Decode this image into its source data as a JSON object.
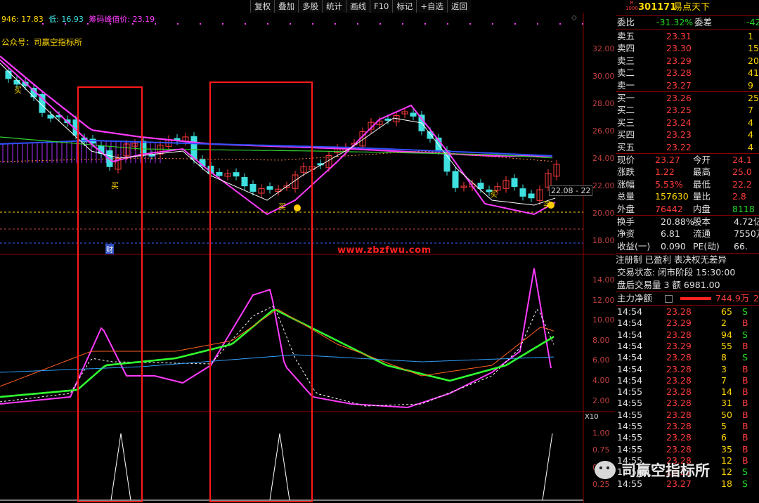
{
  "header_info": {
    "ma1": "946: 17.83",
    "ma2": "低: 16.93",
    "chip": "筹码峰值价: 23.19"
  },
  "watermark_top": "公众号：司赢空指标所",
  "watermark_mid": "www.zbzfwu.com",
  "brand_watermark": "司赢空指标所",
  "toolbar": [
    "复权",
    "叠加",
    "多股",
    "统计",
    "画线",
    "F10",
    "标记",
    "+自选",
    "返回"
  ],
  "price_axis": [
    "32.00",
    "30.00",
    "28.00",
    "26.00",
    "24.00",
    "22.00",
    "20.00",
    "18.00"
  ],
  "mid_axis": [
    "14.00",
    "12.00",
    "10.00",
    "8.00",
    "6.00",
    "4.00",
    "2.00"
  ],
  "low_axis": [
    "1.00",
    "0.75",
    "0.50",
    "0.25"
  ],
  "low_axis_label": "X10",
  "price_tag": "22.08 - 22",
  "labels": {
    "buy": "买",
    "cai": "财"
  },
  "stock": {
    "code": "301171",
    "name": "易点天下",
    "badge_top": "R",
    "badge_bottom": "1000"
  },
  "wei": {
    "label1": "委比",
    "val1": "-31.32%",
    "label2": "委差",
    "val2": "-42"
  },
  "asks": [
    {
      "label": "卖五",
      "price": "23.31",
      "vol": "1"
    },
    {
      "label": "卖四",
      "price": "23.30",
      "vol": "15"
    },
    {
      "label": "卖三",
      "price": "23.29",
      "vol": "20"
    },
    {
      "label": "卖二",
      "price": "23.28",
      "vol": "41"
    },
    {
      "label": "卖一",
      "price": "23.27",
      "vol": "9"
    }
  ],
  "bids": [
    {
      "label": "买一",
      "price": "23.26",
      "vol": "25"
    },
    {
      "label": "买二",
      "price": "23.25",
      "vol": "7"
    },
    {
      "label": "买三",
      "price": "23.24",
      "vol": "4"
    },
    {
      "label": "买四",
      "price": "23.23",
      "vol": "4"
    },
    {
      "label": "买五",
      "price": "23.22",
      "vol": "4"
    }
  ],
  "quote": [
    {
      "l1": "现价",
      "v1": "23.27",
      "c1": "red",
      "l2": "今开",
      "v2": "24.1",
      "c2": "red"
    },
    {
      "l1": "涨跌",
      "v1": "1.22",
      "c1": "red",
      "l2": "最高",
      "v2": "25.0",
      "c2": "red"
    },
    {
      "l1": "涨幅",
      "v1": "5.53%",
      "c1": "red",
      "l2": "最低",
      "v2": "22.2",
      "c2": "red"
    },
    {
      "l1": "总量",
      "v1": "157630",
      "c1": "yellow",
      "l2": "量比",
      "v2": "2.8",
      "c2": "red"
    },
    {
      "l1": "外盘",
      "v1": "76442",
      "c1": "red",
      "l2": "内盘",
      "v2": "8118",
      "c2": "green"
    }
  ],
  "fund": [
    {
      "l1": "换手",
      "v1": "20.88%",
      "l2": "股本",
      "v2": "4.72亿"
    },
    {
      "l1": "净资",
      "v1": "6.81",
      "l2": "流通",
      "v2": "7550万"
    },
    {
      "l1": "收益(一)",
      "v1": "0.090",
      "l2": "PE(动)",
      "v2": "66."
    }
  ],
  "info_lines": [
    "注册制 已盈利 表决权无差异",
    "交易状态: 闭市阶段 15:30:00",
    "盘后交易量 3 额 6981.00"
  ],
  "main_flow": {
    "label": "主力净额",
    "value": "744.9万",
    "tail": "2"
  },
  "ticks": [
    {
      "t": "14:54",
      "p": "23.28",
      "v": "65",
      "s": "S"
    },
    {
      "t": "14:54",
      "p": "23.29",
      "v": "2",
      "s": "B"
    },
    {
      "t": "14:54",
      "p": "23.28",
      "v": "94",
      "s": "S"
    },
    {
      "t": "14:54",
      "p": "23.29",
      "v": "55",
      "s": "B"
    },
    {
      "t": "14:54",
      "p": "23.28",
      "v": "8",
      "s": "S"
    },
    {
      "t": "14:54",
      "p": "23.28",
      "v": "3",
      "s": "B"
    },
    {
      "t": "14:54",
      "p": "23.28",
      "v": "7",
      "s": "B"
    },
    {
      "t": "14:55",
      "p": "23.28",
      "v": "14",
      "s": "B"
    },
    {
      "t": "14:55",
      "p": "23.28",
      "v": "31",
      "s": "B"
    },
    {
      "t": "14:55",
      "p": "23.28",
      "v": "50",
      "s": "B"
    },
    {
      "t": "14:55",
      "p": "23.28",
      "v": "5",
      "s": "B"
    },
    {
      "t": "14:55",
      "p": "23.28",
      "v": "6",
      "s": "B"
    },
    {
      "t": "14:55",
      "p": "23.28",
      "v": "35",
      "s": "B"
    },
    {
      "t": "14:55",
      "p": "23.28",
      "v": "12",
      "s": "B"
    },
    {
      "t": "14:55",
      "p": "23.27",
      "v": "12",
      "s": "S"
    },
    {
      "t": "14:55",
      "p": "23.27",
      "v": "18",
      "s": "S"
    }
  ]
}
